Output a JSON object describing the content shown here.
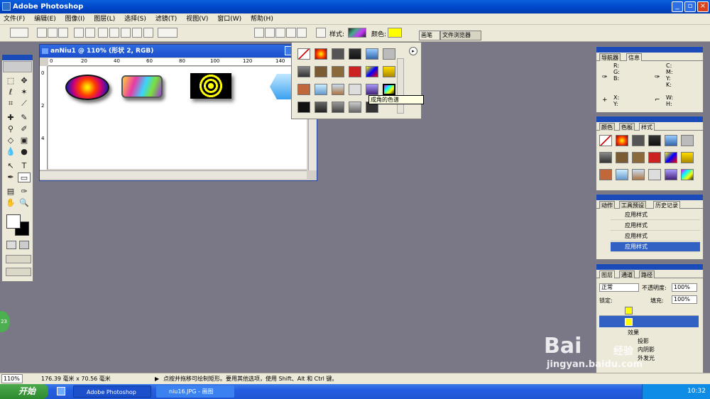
{
  "window": {
    "title": "Adobe Photoshop"
  },
  "menu": [
    "文件(F)",
    "编辑(E)",
    "图像(I)",
    "图层(L)",
    "选择(S)",
    "滤镜(T)",
    "视图(V)",
    "窗口(W)",
    "帮助(H)"
  ],
  "options": {
    "style_label": "样式:",
    "color_label": "颜色:",
    "color_value": "#ffff00",
    "tab_brush": "画笔",
    "tab_browser": "文件浏览器"
  },
  "document": {
    "title": "anNiu1 @ 110% (形状 2, RGB)",
    "ruler_ticks": [
      "0",
      "20",
      "40",
      "60",
      "80",
      "100",
      "120",
      "140"
    ],
    "ruler_v": [
      "0",
      "2",
      "4"
    ]
  },
  "styles_popup": {
    "tooltip": "成角的色谱"
  },
  "panels": {
    "navigator": {
      "tabs": [
        "导航器",
        "信息"
      ],
      "rgb": "R:\nG:\nB:",
      "cmyk": "C:\nM:\nY:\nK:",
      "xy": "X:\nY:",
      "wh": "W:\nH:"
    },
    "color": {
      "tabs": [
        "颜色",
        "色板",
        "样式"
      ]
    },
    "history": {
      "tabs": [
        "动作",
        "工具预设",
        "历史记录"
      ],
      "items": [
        "应用样式",
        "应用样式",
        "应用样式",
        "应用样式"
      ]
    },
    "layers": {
      "tabs": [
        "图层",
        "通道",
        "路径"
      ],
      "blend_mode": "正常",
      "opacity_label": "不透明度:",
      "opacity_value": "100%",
      "lock_label": "锁定:",
      "fill_label": "填充:",
      "fill_value": "100%",
      "effects_label": "效果",
      "effect1": "投影",
      "effect2": "内阴影",
      "effect3": "外发光"
    }
  },
  "status": {
    "zoom": "110%",
    "doc_size": "176.39 毫米 x 70.56 毫米",
    "hint": "点按并拖移可绘制矩形。要用其他选项，使用 Shift、Alt 和 Ctrl 键。"
  },
  "taskbar": {
    "start": "开始",
    "task1": "Adobe Photoshop",
    "task2": "niu16.JPG - 画图",
    "clock": "10:32"
  },
  "watermark": {
    "brand": "Bai",
    "suffix": "经验",
    "url": "jingyan.baidu.com"
  }
}
